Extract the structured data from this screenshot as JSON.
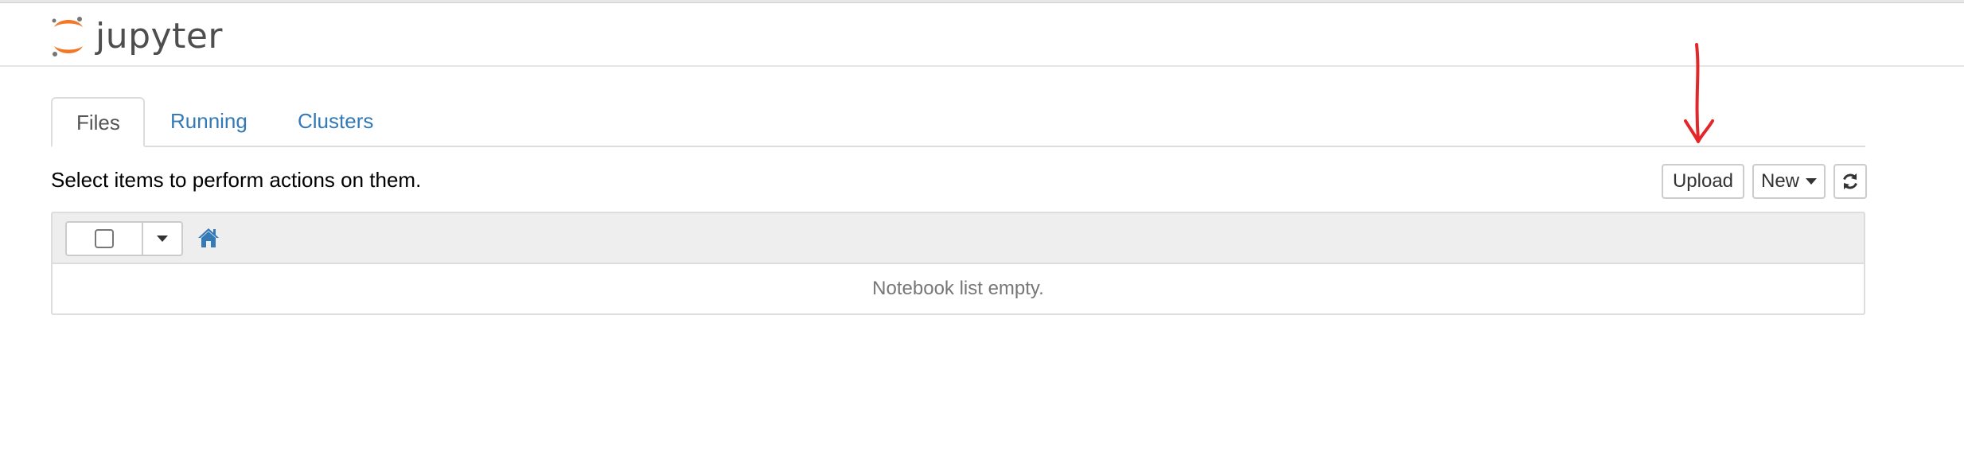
{
  "header": {
    "logo_text": "jupyter",
    "logo_icon": "jupyter-logo-icon"
  },
  "tabs": [
    {
      "label": "Files",
      "active": true
    },
    {
      "label": "Running",
      "active": false
    },
    {
      "label": "Clusters",
      "active": false
    }
  ],
  "main": {
    "hint": "Select items to perform actions on them.",
    "buttons": {
      "upload": "Upload",
      "new": "New",
      "refresh_icon": "refresh-icon"
    },
    "list": {
      "empty_message": "Notebook list empty.",
      "home_icon": "home-icon"
    }
  },
  "colors": {
    "link": "#337ab7",
    "logo_orange": "#f37726",
    "annotation": "#e3262a"
  }
}
